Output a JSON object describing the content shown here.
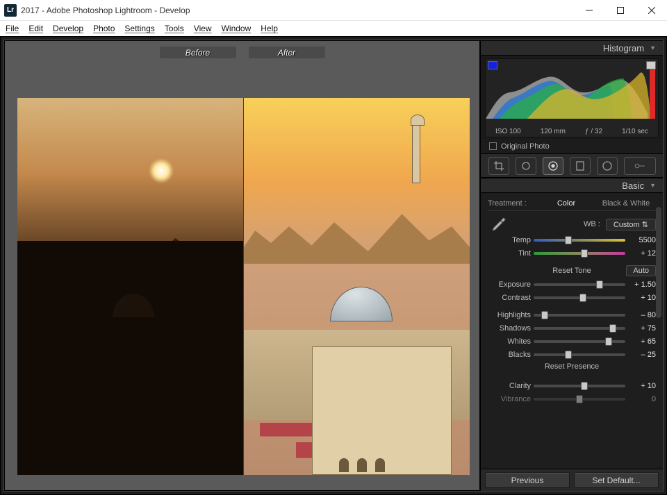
{
  "window": {
    "app_icon_text": "Lr",
    "title": "2017 - Adobe Photoshop Lightroom - Develop"
  },
  "menu": [
    "File",
    "Edit",
    "Develop",
    "Photo",
    "Settings",
    "Tools",
    "View",
    "Window",
    "Help"
  ],
  "compare": {
    "before": "Before",
    "after": "After"
  },
  "panels": {
    "histogram": {
      "title": "Histogram",
      "meta": {
        "iso": "ISO 100",
        "focal": "120 mm",
        "aperture": "ƒ / 32",
        "shutter": "1/10 sec"
      },
      "original_label": "Original Photo"
    },
    "basic": {
      "title": "Basic",
      "treatment_label": "Treatment :",
      "treatment_color": "Color",
      "treatment_bw": "Black & White",
      "wb_label": "WB :",
      "wb_value": "Custom",
      "reset_tone": "Reset Tone",
      "auto": "Auto",
      "reset_presence": "Reset Presence",
      "sliders": {
        "temp": {
          "name": "Temp",
          "value": "5500",
          "pos": 38
        },
        "tint": {
          "name": "Tint",
          "value": "+ 12",
          "pos": 55
        },
        "exposure": {
          "name": "Exposure",
          "value": "+ 1.50",
          "pos": 72
        },
        "contrast": {
          "name": "Contrast",
          "value": "+ 10",
          "pos": 54
        },
        "highlights": {
          "name": "Highlights",
          "value": "– 80",
          "pos": 12
        },
        "shadows": {
          "name": "Shadows",
          "value": "+ 75",
          "pos": 86
        },
        "whites": {
          "name": "Whites",
          "value": "+ 65",
          "pos": 82
        },
        "blacks": {
          "name": "Blacks",
          "value": "– 25",
          "pos": 38
        },
        "clarity": {
          "name": "Clarity",
          "value": "+ 10",
          "pos": 55
        },
        "vibrance": {
          "name": "Vibrance",
          "value": "0",
          "pos": 50
        }
      }
    }
  },
  "footer": {
    "previous": "Previous",
    "set_default": "Set Default..."
  }
}
